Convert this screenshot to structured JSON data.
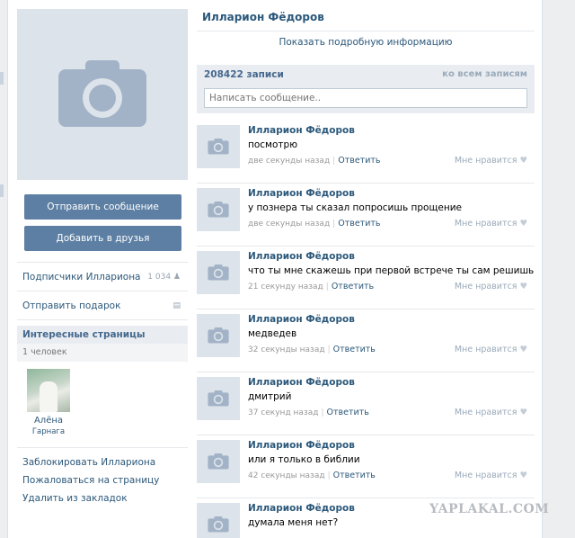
{
  "profile": {
    "name": "Илларион Фёдоров",
    "more_info": "Показать подробную информацию",
    "send_message": "Отправить сообщение",
    "add_friend": "Добавить в друзья"
  },
  "sidebar": {
    "followers_label": "Подписчики Иллариона",
    "followers_count": "1 034",
    "gift_label": "Отправить подарок",
    "interesting_title": "Интересные страницы",
    "interesting_count": "1 человек",
    "interesting_item": {
      "name": "Алёна",
      "city": "Гарнага"
    },
    "actions": [
      "Заблокировать Иллариона",
      "Пожаловаться на страницу",
      "Удалить из закладок"
    ]
  },
  "wall": {
    "count_label": "208422 записи",
    "all_label": "ко всем записям",
    "composer_placeholder": "Написать сообщение..",
    "reply_label": "Ответить",
    "like_label": "Мне нравится",
    "posts": [
      {
        "author": "Илларион Фёдоров",
        "text": "посмотрю",
        "time": "две секунды назад"
      },
      {
        "author": "Илларион Фёдоров",
        "text": "у познера ты сказал попросишь прощение",
        "time": "две секунды назад"
      },
      {
        "author": "Илларион Фёдоров",
        "text": "что ты мне скажешь при первой встрече ты сам решишь",
        "time": "21 секунду назад"
      },
      {
        "author": "Илларион Фёдоров",
        "text": "медведев",
        "time": "32 секунды назад"
      },
      {
        "author": "Илларион Фёдоров",
        "text": "дмитрий",
        "time": "37 секунд назад"
      },
      {
        "author": "Илларион Фёдоров",
        "text": "или я только в библии",
        "time": "42 секунды назад"
      },
      {
        "author": "Илларион Фёдоров",
        "text": "думала меня нет?",
        "time": ""
      }
    ]
  },
  "watermark": "YAPLAKAL.COM",
  "colors": {
    "link": "#2b587a",
    "button": "#5d7fa3",
    "header_bg": "#e9edf1"
  }
}
